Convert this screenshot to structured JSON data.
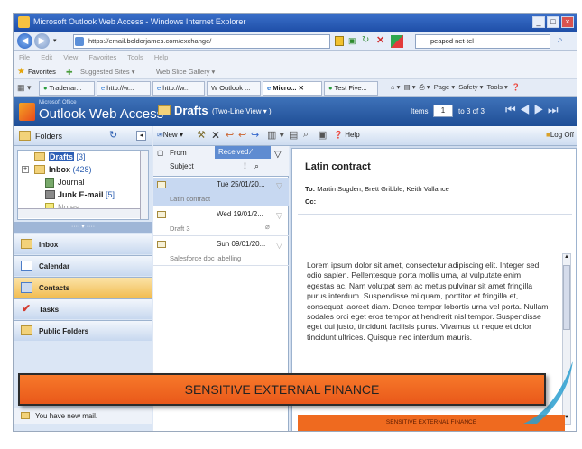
{
  "browser": {
    "title": "Microsoft Outlook Web Access - Windows Internet Explorer",
    "url": "https://email.boldorjames.com/exchange/",
    "search_text": "peapod net-tel",
    "menu": [
      "File",
      "Edit",
      "View",
      "Favorites",
      "Tools",
      "Help"
    ],
    "favorites_label": "Favorites",
    "suggested_sites": "Suggested Sites",
    "web_slice_gallery": "Web Slice Gallery",
    "tabs": [
      "Tradenar...",
      "http://w...",
      "http://w...",
      "Outlook ...",
      "Micro...",
      "Test Five..."
    ],
    "toolbar": {
      "page": "Page",
      "safety": "Safety",
      "tools": "Tools"
    }
  },
  "owa": {
    "brand": "Outlook Web Access",
    "brand_small": "Microsoft Office",
    "folder_title": "Drafts",
    "view_mode": "(Two-Line View",
    "items_label": "Items",
    "items_page": "1",
    "items_range": "to 3 of 3",
    "toolbar": {
      "new": "New",
      "help": "Help",
      "logoff": "Log Off"
    }
  },
  "folders": {
    "header": "Folders",
    "tree": [
      {
        "name": "Drafts",
        "count": "[3]"
      },
      {
        "name": "Inbox",
        "count": "(428)"
      },
      {
        "name": "Journal",
        "count": ""
      },
      {
        "name": "Junk E-mail",
        "count": "[5]"
      },
      {
        "name": "Notes",
        "count": ""
      }
    ],
    "nav": [
      "Inbox",
      "Calendar",
      "Contacts",
      "Tasks",
      "Public Folders"
    ],
    "new_mail": "You have new mail."
  },
  "list": {
    "col_from": "From",
    "col_received": "Received",
    "col_subject": "Subject",
    "items": [
      {
        "date": "Tue 25/01/20...",
        "subject": "Latin contract"
      },
      {
        "date": "Wed 19/01/2...",
        "subject": "Draft 3"
      },
      {
        "date": "Sun 09/01/20...",
        "subject": "Salesforce doc labelling"
      }
    ]
  },
  "message": {
    "subject": "Latin contract",
    "to_label": "To:",
    "to": "Martin Sugden; Brett Gribble; Keith Vallance",
    "cc_label": "Cc:",
    "body": "Lorem ipsum dolor sit amet, consectetur adipiscing elit. Integer sed odio sapien. Pellentesque porta mollis urna, at vulputate enim egestas ac. Nam volutpat sem ac metus pulvinar sit amet fringilla purus interdum. Suspendisse mi quam, porttitor et fringilla et, consequat laoreet diam. Donec tempor lobortis urna vel porta. Nullam sodales orci eget eros tempor at hendrerit nisl tempor. Suspendisse eget dui justo, tincidunt facilisis purus. Vivamus ut neque et dolor tincidunt ultrices. Quisque nec interdum mauris.",
    "footer_label": "SENSITIVE EXTERNAL FINANCE"
  },
  "banner": {
    "text": "SENSITIVE EXTERNAL FINANCE"
  }
}
